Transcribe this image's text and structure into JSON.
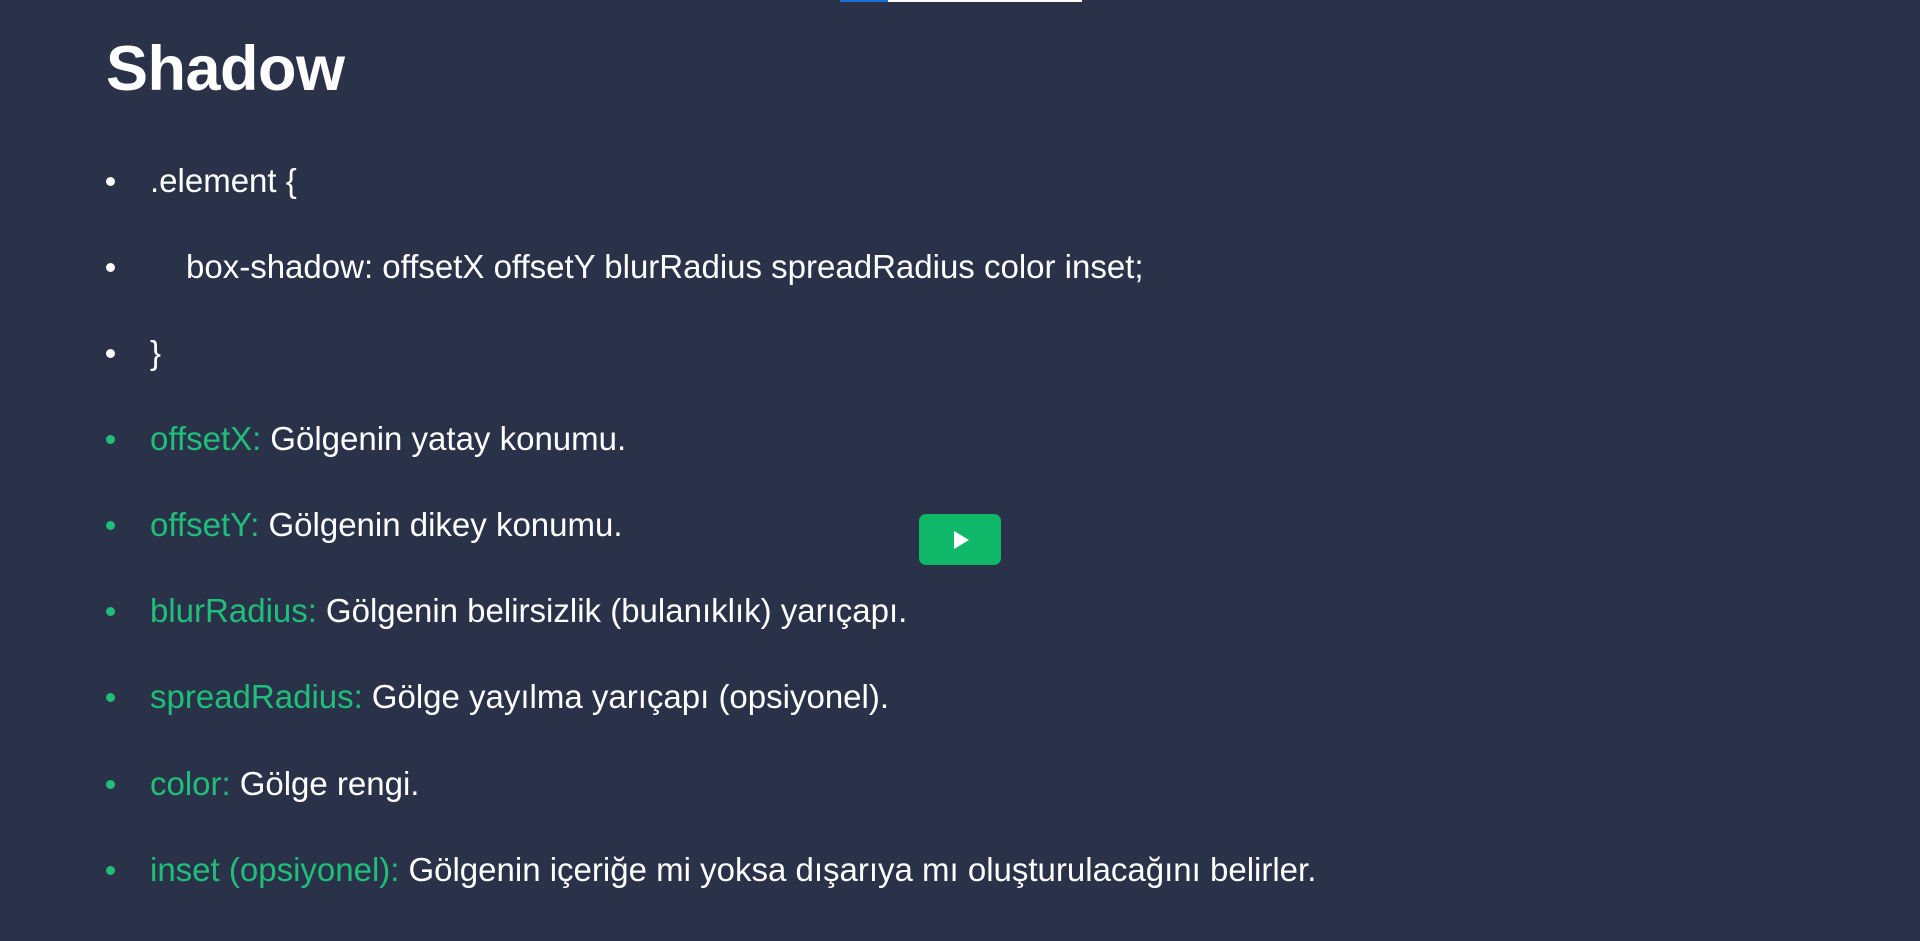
{
  "slide": {
    "title": "Shadow",
    "progress": 0.2
  },
  "code_lines": [
    ".element {",
    "box-shadow: offsetX offsetY blurRadius spreadRadius color inset;",
    "}"
  ],
  "definitions": [
    {
      "key": "offsetX:",
      "text": "Gölgenin yatay konumu."
    },
    {
      "key": "offsetY:",
      "text": "Gölgenin dikey konumu."
    },
    {
      "key": "blurRadius:",
      "text": "Gölgenin belirsizlik (bulanıklık) yarıçapı."
    },
    {
      "key": "spreadRadius:",
      "text": "Gölge yayılma yarıçapı (opsiyonel)."
    },
    {
      "key": "color:",
      "text": "Gölge rengi."
    },
    {
      "key": "inset (opsiyonel):",
      "text": "Gölgenin içeriğe mi yoksa dışarıya mı oluşturulacağını belirler."
    }
  ],
  "play_button": {
    "icon": "play-icon"
  },
  "colors": {
    "background": "#2a3249",
    "accent": "#1fbf7a",
    "button": "#0fb769",
    "progress": "#1d6fd6"
  }
}
